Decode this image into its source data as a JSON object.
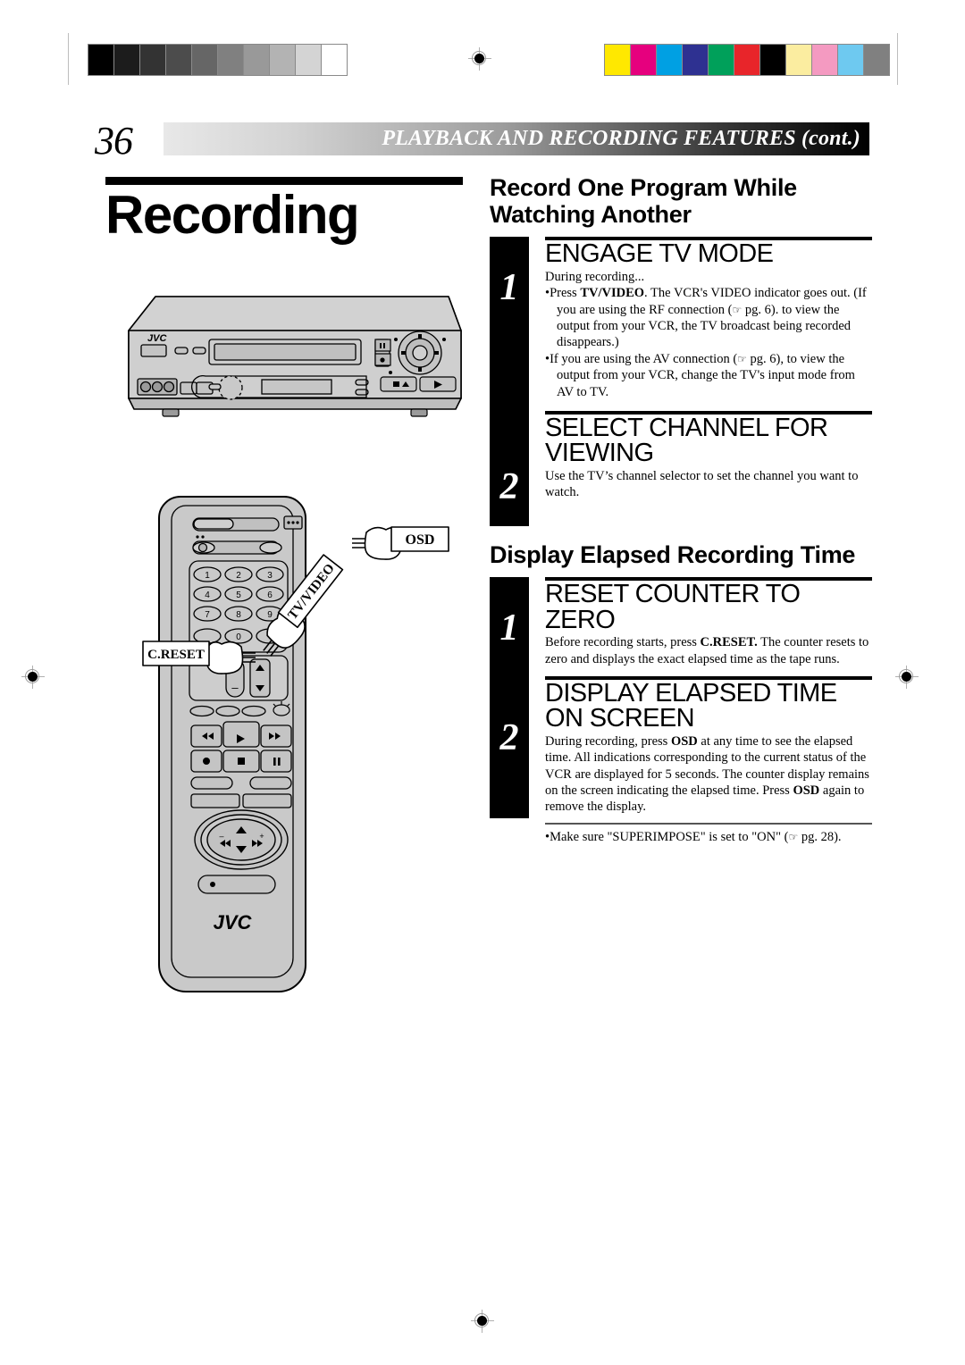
{
  "print_marks": {
    "gray_wedge": [
      "#000000",
      "#1c1c1c",
      "#333333",
      "#4c4c4c",
      "#666666",
      "#808080",
      "#999999",
      "#b3b3b3",
      "#d4d4d4",
      "#ffffff"
    ],
    "color_bars": [
      "#ffe800",
      "#e6007e",
      "#00a0e3",
      "#2e3191",
      "#00a05a",
      "#e8252a",
      "#000000",
      "#fbeda0",
      "#f49ac1",
      "#6ec9f0",
      "#808080"
    ],
    "registration_icon": "registration-target-icon"
  },
  "header": {
    "page_number": "36",
    "title": "PLAYBACK AND RECORDING FEATURES (cont.)"
  },
  "left": {
    "doc_title": "Recording",
    "vcr": {
      "brand": "JVC",
      "icon_eject": "eject-icon",
      "icon_play": "play-icon",
      "icon_pause": "pause-icon",
      "icon_record": "record-icon"
    },
    "remote": {
      "brand": "JVC",
      "keys": [
        "1",
        "2",
        "3",
        "4",
        "5",
        "6",
        "7",
        "8",
        "9",
        "0"
      ],
      "plus": "+",
      "minus": "–",
      "icon_rewind": "rewind-icon",
      "icon_play": "play-icon",
      "icon_fastforward": "fast-forward-icon",
      "icon_record": "record-icon",
      "icon_stop": "stop-icon",
      "icon_pause": "pause-icon",
      "icon_power": "power-icon",
      "icon_light": "light-icon",
      "icon_up": "▲",
      "icon_down": "▼",
      "icon_prev": "⏮",
      "icon_next": "⏭"
    },
    "callouts": {
      "osd": "OSD",
      "creset": "C.RESET",
      "tvvideo": "TV/VIDEO"
    }
  },
  "right": {
    "section1": {
      "heading": "Record One Program While Watching Another",
      "steps": [
        {
          "number": "1",
          "title": "ENGAGE TV MODE",
          "intro": "During recording...",
          "bullets": [
            "Press TV/VIDEO. The VCR's VIDEO indicator goes out. (If you are using the RF connection (☞ pg. 6). to view the output from your VCR, the TV broadcast being recorded disappears.)",
            "If you are using the AV connection (☞ pg. 6), to view the output from your VCR, change the TV's input mode from AV to TV."
          ]
        },
        {
          "number": "2",
          "title": "SELECT CHANNEL FOR VIEWING",
          "body": "Use the TV’s channel selector to set the channel you want to watch."
        }
      ]
    },
    "section2": {
      "heading": "Display Elapsed Recording Time",
      "steps": [
        {
          "number": "1",
          "title": "RESET COUNTER TO ZERO",
          "body": "Before recording starts, press C.RESET. The counter resets to zero and displays the exact elapsed time as the tape runs."
        },
        {
          "number": "2",
          "title": "DISPLAY ELAPSED TIME ON SCREEN",
          "body": "During recording, press OSD at any time to see the elapsed time. All indications corresponding to the current status of the VCR are displayed for 5 seconds. The counter display remains on the screen indicating the elapsed time. Press OSD again to remove the display.",
          "note": "Make sure \"SUPERIMPOSE\" is set to \"ON\" (☞ pg. 28)."
        }
      ]
    }
  }
}
